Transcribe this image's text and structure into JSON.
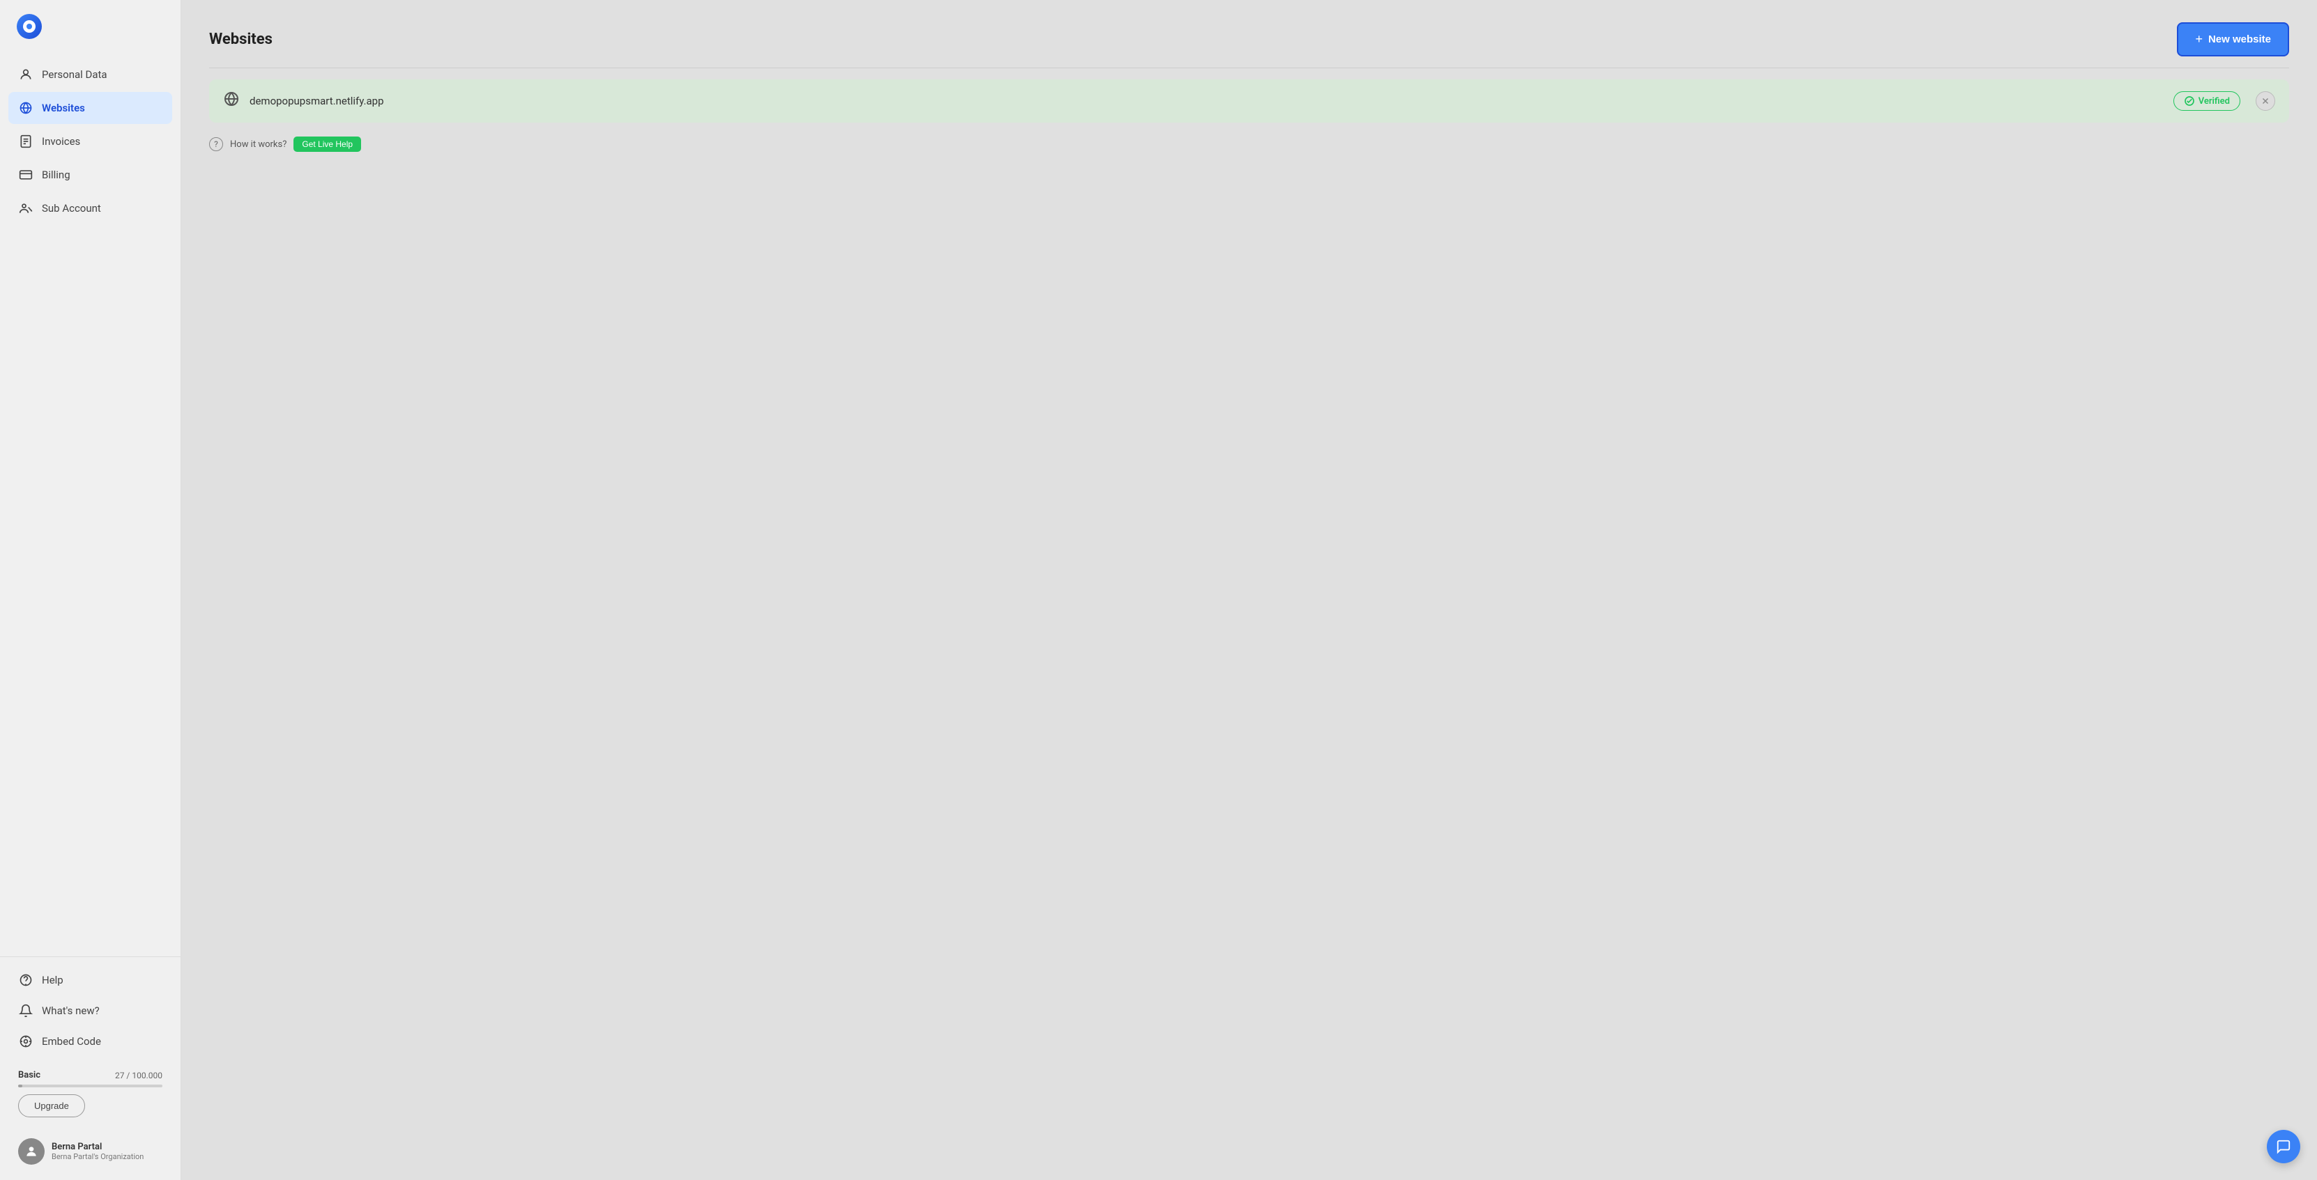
{
  "sidebar": {
    "nav_items": [
      {
        "id": "personal-data",
        "label": "Personal Data",
        "icon": "person",
        "active": false
      },
      {
        "id": "websites",
        "label": "Websites",
        "icon": "globe",
        "active": true
      },
      {
        "id": "invoices",
        "label": "Invoices",
        "icon": "invoice",
        "active": false
      },
      {
        "id": "billing",
        "label": "Billing",
        "icon": "billing",
        "active": false
      },
      {
        "id": "sub-account",
        "label": "Sub Account",
        "icon": "sub-account",
        "active": false
      }
    ],
    "bottom_items": [
      {
        "id": "help",
        "label": "Help",
        "icon": "help"
      },
      {
        "id": "whats-new",
        "label": "What's new?",
        "icon": "bell"
      },
      {
        "id": "embed-code",
        "label": "Embed Code",
        "icon": "embed"
      }
    ],
    "plan": {
      "name": "Basic",
      "used": 27,
      "total": 100000,
      "display": "27 / 100.000",
      "fill_percent": 0.027
    },
    "upgrade_label": "Upgrade",
    "user": {
      "name": "Berna Partal",
      "org": "Berna Partal's Organization"
    }
  },
  "header": {
    "title": "Websites",
    "new_button_label": "New website"
  },
  "website": {
    "url": "demopopupsmart.netlify.app",
    "verified_label": "Verified"
  },
  "how_it_works": {
    "text": "How it works?",
    "live_help_label": "Get Live Help"
  }
}
